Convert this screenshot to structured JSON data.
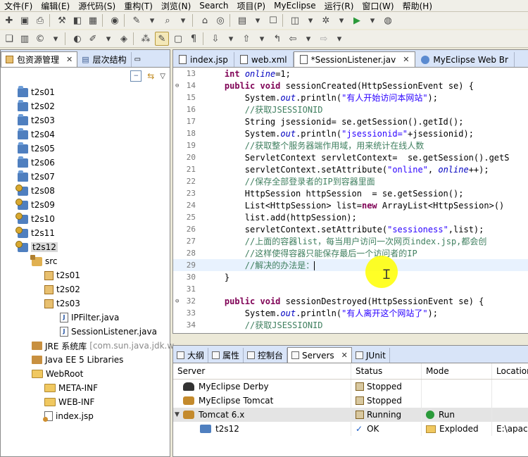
{
  "menu": [
    "文件(F)",
    "编辑(E)",
    "源代码(S)",
    "重构(T)",
    "浏览(N)",
    "Search",
    "项目(P)",
    "MyEclipse",
    "运行(R)",
    "窗口(W)",
    "帮助(H)"
  ],
  "left_tabs": {
    "explorer": "包资源管理",
    "hierarchy": "层次结构"
  },
  "tree": [
    {
      "label": "t2s01",
      "icon": "project"
    },
    {
      "label": "t2s02",
      "icon": "project"
    },
    {
      "label": "t2s03",
      "icon": "project"
    },
    {
      "label": "t2s04",
      "icon": "project"
    },
    {
      "label": "t2s05",
      "icon": "project"
    },
    {
      "label": "t2s06",
      "icon": "project"
    },
    {
      "label": "t2s07",
      "icon": "project"
    },
    {
      "label": "t2s08",
      "icon": "web-project"
    },
    {
      "label": "t2s09",
      "icon": "web-project"
    },
    {
      "label": "t2s10",
      "icon": "web-project"
    },
    {
      "label": "t2s11",
      "icon": "web-project"
    },
    {
      "label": "t2s12",
      "icon": "web-project",
      "selected": true
    },
    {
      "label": "src",
      "icon": "source-folder"
    },
    {
      "label": "t2s01",
      "icon": "package"
    },
    {
      "label": "t2s02",
      "icon": "package"
    },
    {
      "label": "t2s03",
      "icon": "package"
    },
    {
      "label": "IPFilter.java",
      "icon": "java-file"
    },
    {
      "label": "SessionListener.java",
      "icon": "java-file"
    },
    {
      "label": "JRE 系统库",
      "suffix": "[com.sun.java.jdk.w",
      "icon": "library"
    },
    {
      "label": "Java EE 5 Libraries",
      "icon": "library"
    },
    {
      "label": "WebRoot",
      "icon": "folder"
    },
    {
      "label": "META-INF",
      "icon": "folder"
    },
    {
      "label": "WEB-INF",
      "icon": "folder"
    },
    {
      "label": "index.jsp",
      "icon": "jsp-file"
    }
  ],
  "editor_tabs": [
    {
      "label": "index.jsp",
      "icon": "file"
    },
    {
      "label": "web.xml",
      "icon": "file"
    },
    {
      "label": "*SessionListener.jav",
      "icon": "file",
      "active": true
    },
    {
      "label": "MyEclipse Web Br",
      "icon": "globe"
    }
  ],
  "code_lines": [
    {
      "n": "13",
      "html": "    <span class='kw'>int</span> <span class='fld'>online</span>=1;"
    },
    {
      "n": "14",
      "fold": "⊖",
      "html": "    <span class='kw'>public</span> <span class='kw'>void</span> sessionCreated(HttpSessionEvent se) {"
    },
    {
      "n": "15",
      "html": "        System.<span class='fld'>out</span>.println(<span class='str'>\"有人开始访问本网站\"</span>);"
    },
    {
      "n": "16",
      "html": "        <span class='cm'>//获取JSESSIONID</span>"
    },
    {
      "n": "17",
      "html": "        String jsessionid= se.getSession().getId();"
    },
    {
      "n": "18",
      "html": "        System.<span class='fld'>out</span>.println(<span class='str'>\"jsessionid=\"</span>+jsessionid);"
    },
    {
      "n": "19",
      "html": "        <span class='cm'>//获取整个服务器端作用域，用来统计在线人数</span>"
    },
    {
      "n": "20",
      "html": "        ServletContext servletContext=  se.getSession().getS"
    },
    {
      "n": "21",
      "html": "        servletContext.setAttribute(<span class='str'>\"online\"</span>, <span class='fld'>online</span>++);"
    },
    {
      "n": "22",
      "html": "        <span class='cm'>//保存全部登录者的IP到容器里面</span>"
    },
    {
      "n": "23",
      "html": "        HttpSession httpSession  = se.getSession();"
    },
    {
      "n": "24",
      "html": "        List&lt;HttpSession&gt; list=<span class='kw'>new</span> ArrayList&lt;HttpSession&gt;()"
    },
    {
      "n": "25",
      "html": "        list.add(httpSession);"
    },
    {
      "n": "26",
      "html": "        servletContext.setAttribute(<span class='str'>\"sessioness\"</span>,list);"
    },
    {
      "n": "27",
      "html": "        <span class='cm'>//上面的容器list，每当用户访问一次网页index.jsp,都会创</span>"
    },
    {
      "n": "28",
      "html": "        <span class='cm'>//这样使得容器只能保存最后一个访问者的IP</span>"
    },
    {
      "n": "29",
      "current": true,
      "html": "        <span class='cm'>//解决的办法是：</span><span class='caret'></span>"
    },
    {
      "n": "30",
      "html": "    }"
    },
    {
      "n": "31",
      "html": ""
    },
    {
      "n": "32",
      "fold": "⊖",
      "html": "    <span class='kw'>public</span> <span class='kw'>void</span> sessionDestroyed(HttpSessionEvent se) {"
    },
    {
      "n": "33",
      "html": "        System.<span class='fld'>out</span>.println(<span class='str'>\"有人离开这个网站了\"</span>);"
    },
    {
      "n": "34",
      "html": "        <span class='cm'>//获取JSESSIONID</span>"
    }
  ],
  "bottom_tabs": [
    "大纲",
    "属性",
    "控制台",
    "Servers",
    "JUnit"
  ],
  "servers": {
    "columns": [
      "Server",
      "Status",
      "Mode",
      "Location"
    ],
    "rows": [
      {
        "name": "MyEclipse Derby",
        "icon": "derby",
        "status": "Stopped",
        "mode": "",
        "location": ""
      },
      {
        "name": "MyEclipse Tomcat",
        "icon": "tomcat",
        "status": "Stopped",
        "mode": "",
        "location": ""
      },
      {
        "name": "Tomcat  6.x",
        "icon": "tomcat",
        "status": "Running",
        "mode": "Run",
        "location": "",
        "expanded": true,
        "selected": true
      },
      {
        "name": "t2s12",
        "icon": "project",
        "status": "OK",
        "mode": "Exploded",
        "location": "E:\\apach",
        "child": true
      }
    ]
  }
}
